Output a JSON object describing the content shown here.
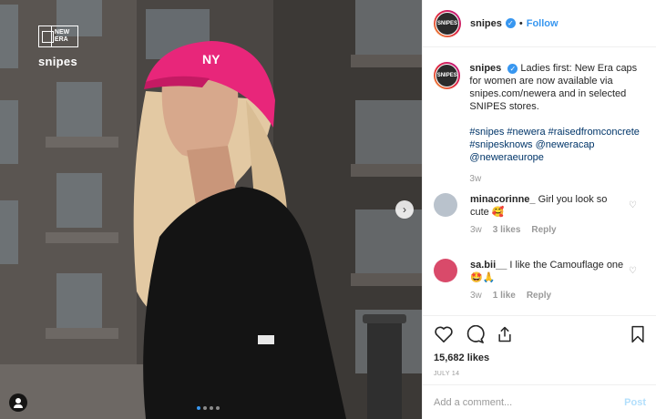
{
  "photo": {
    "brand_logo_text": "NEW ERA",
    "snipes_logo": "snipes",
    "next_icon": "chevron-right-icon",
    "carousel_total": 4,
    "carousel_active": 1
  },
  "header": {
    "avatar_text": "SNIPES",
    "username": "snipes",
    "verified_mark": "✓",
    "separator": "•",
    "follow_label": "Follow"
  },
  "caption": {
    "username": "snipes",
    "text": "Ladies first: New Era caps for women are now available via snipes.com/newera and in selected SNIPES stores.",
    "hashtags": "#snipes #newera #raisedfromconcrete #snipesknows @neweracap @neweraeurope",
    "time": "3w"
  },
  "comments": [
    {
      "username": "minacorinne_",
      "text": "Girl you look so cute 🥰",
      "time": "3w",
      "likes": "3 likes",
      "reply": "Reply"
    },
    {
      "username": "sa.bii__",
      "text": "I like the Camouflage one 🤩🙏",
      "time": "3w",
      "likes": "1 like",
      "reply": "Reply"
    }
  ],
  "actions": {
    "likes": "15,682 likes",
    "date": "JULY 14"
  },
  "composer": {
    "placeholder": "Add a comment...",
    "post_label": "Post"
  },
  "colors": {
    "accent": "#3897f0",
    "cap": "#e8267a"
  }
}
